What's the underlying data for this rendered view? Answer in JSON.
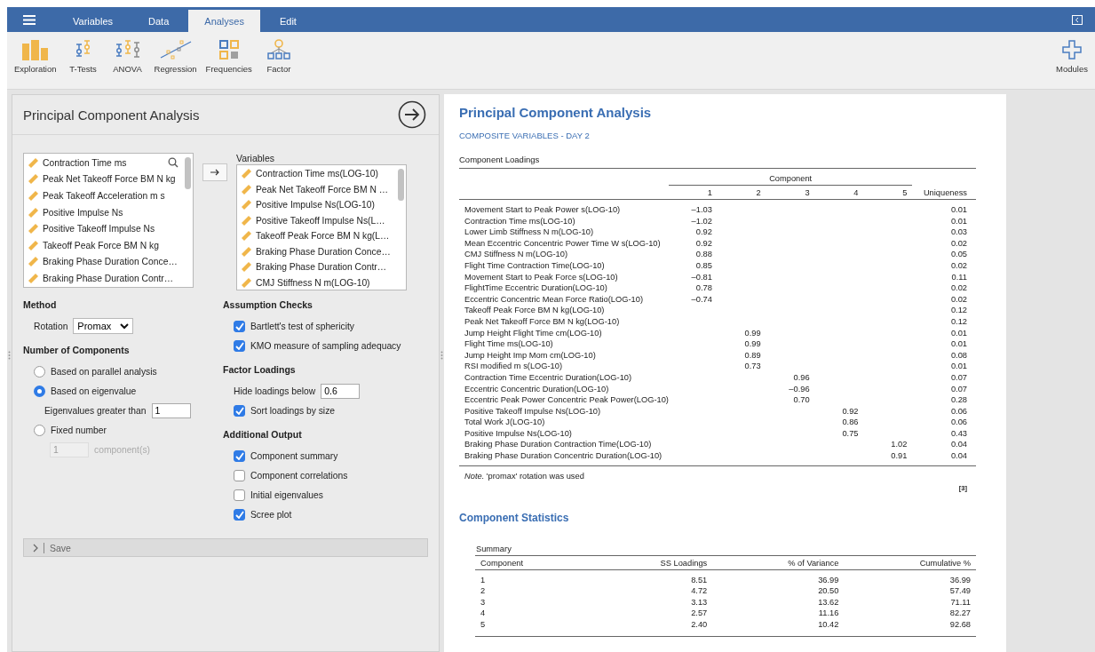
{
  "menu_tabs": [
    {
      "label": "Variables",
      "selected": false
    },
    {
      "label": "Data",
      "selected": false
    },
    {
      "label": "Analyses",
      "selected": true
    },
    {
      "label": "Edit",
      "selected": false
    }
  ],
  "ribbon": [
    "Exploration",
    "T-Tests",
    "ANOVA",
    "Regression",
    "Frequencies",
    "Factor"
  ],
  "modules": "Modules",
  "analysis_panel": {
    "title": "Principal Component Analysis",
    "source_variables": [
      "Contraction Time ms",
      "Peak Net Takeoff Force BM N kg",
      "Peak Takeoff Acceleration m s",
      "Positive Impulse Ns",
      "Positive Takeoff Impulse Ns",
      "Takeoff Peak Force BM N kg",
      "Braking Phase Duration Conce…",
      "Braking Phase Duration Contr…"
    ],
    "variables_label": "Variables",
    "variables": [
      "Contraction Time ms(LOG-10)",
      "Peak Net Takeoff Force BM N …",
      "Positive Impulse Ns(LOG-10)",
      "Positive Takeoff Impulse Ns(L…",
      "Takeoff Peak Force BM N kg(L…",
      "Braking Phase Duration Conce…",
      "Braking Phase Duration Contr…",
      "CMJ Stiffness N m(LOG-10)"
    ],
    "method": {
      "heading": "Method",
      "rotation_label": "Rotation",
      "rotation": "Promax"
    },
    "number_of_components": {
      "heading": "Number of Components",
      "options": [
        {
          "label": "Based on parallel analysis",
          "selected": false
        },
        {
          "label": "Based on eigenvalue",
          "selected": true,
          "field_label": "Eigenvalues greater than",
          "value": "1",
          "disabled": false
        },
        {
          "label": "Fixed number",
          "selected": false,
          "value": "1",
          "unit": "component(s)",
          "disabled": true
        }
      ]
    },
    "assumption_checks": {
      "heading": "Assumption Checks",
      "items": [
        {
          "label": "Bartlett's test of sphericity",
          "checked": true
        },
        {
          "label": "KMO measure of sampling adequacy",
          "checked": true
        }
      ]
    },
    "factor_loadings": {
      "heading": "Factor Loadings",
      "hide_label": "Hide loadings below",
      "hide_value": "0.6",
      "items": [
        {
          "label": "Sort loadings by size",
          "checked": true
        }
      ]
    },
    "additional_output": {
      "heading": "Additional Output",
      "items": [
        {
          "label": "Component summary",
          "checked": true
        },
        {
          "label": "Component correlations",
          "checked": false
        },
        {
          "label": "Initial eigenvalues",
          "checked": false
        },
        {
          "label": "Scree plot",
          "checked": true
        }
      ]
    },
    "save": {
      "label": "Save",
      "expanded": false
    }
  },
  "results": {
    "title": "Principal Component Analysis",
    "subtitle": "COMPOSITE VARIABLES - DAY 2",
    "loadings_table": {
      "caption": "Component Loadings",
      "group_header": "Component",
      "columns": [
        "1",
        "2",
        "3",
        "4",
        "5"
      ],
      "uniqueness_header": "Uniqueness",
      "rows": [
        {
          "name": "Movement Start to Peak Power s(LOG-10)",
          "loadings": {
            "1": "–1.03"
          },
          "uniqueness": "0.01"
        },
        {
          "name": "Contraction Time ms(LOG-10)",
          "loadings": {
            "1": "–1.02"
          },
          "uniqueness": "0.01"
        },
        {
          "name": "Lower Limb Stiffness N m(LOG-10)",
          "loadings": {
            "1": "0.92"
          },
          "uniqueness": "0.03"
        },
        {
          "name": "Mean Eccentric Concentric Power Time W s(LOG-10)",
          "loadings": {
            "1": "0.92"
          },
          "uniqueness": "0.02"
        },
        {
          "name": "CMJ Stiffness N m(LOG-10)",
          "loadings": {
            "1": "0.88"
          },
          "uniqueness": "0.05"
        },
        {
          "name": "Flight Time Contraction Time(LOG-10)",
          "loadings": {
            "1": "0.85"
          },
          "uniqueness": "0.02"
        },
        {
          "name": "Movement Start to Peak Force s(LOG-10)",
          "loadings": {
            "1": "–0.81"
          },
          "uniqueness": "0.11"
        },
        {
          "name": "FlightTime Eccentric Duration(LOG-10)",
          "loadings": {
            "1": "0.78"
          },
          "uniqueness": "0.02"
        },
        {
          "name": "Eccentric Concentric Mean Force Ratio(LOG-10)",
          "loadings": {
            "1": "–0.74"
          },
          "uniqueness": "0.02"
        },
        {
          "name": "Takeoff Peak Force BM N kg(LOG-10)",
          "uniqueness": "0.12"
        },
        {
          "name": "Peak Net Takeoff Force BM N kg(LOG-10)",
          "uniqueness": "0.12"
        },
        {
          "name": "Jump Height Flight Time cm(LOG-10)",
          "loadings": {
            "2": "0.99"
          },
          "uniqueness": "0.01"
        },
        {
          "name": "Flight Time ms(LOG-10)",
          "loadings": {
            "2": "0.99"
          },
          "uniqueness": "0.01"
        },
        {
          "name": "Jump Height Imp Mom cm(LOG-10)",
          "loadings": {
            "2": "0.89"
          },
          "uniqueness": "0.08"
        },
        {
          "name": "RSI modified m s(LOG-10)",
          "loadings": {
            "2": "0.73"
          },
          "uniqueness": "0.01"
        },
        {
          "name": "Contraction Time Eccentric Duration(LOG-10)",
          "loadings": {
            "3": "0.96"
          },
          "uniqueness": "0.07"
        },
        {
          "name": "Eccentric Concentric Duration(LOG-10)",
          "loadings": {
            "3": "–0.96"
          },
          "uniqueness": "0.07"
        },
        {
          "name": "Eccentric Peak Power Concentric Peak Power(LOG-10)",
          "loadings": {
            "3": "0.70"
          },
          "uniqueness": "0.28"
        },
        {
          "name": "Positive Takeoff Impulse Ns(LOG-10)",
          "loadings": {
            "4": "0.92"
          },
          "uniqueness": "0.06"
        },
        {
          "name": "Total Work J(LOG-10)",
          "loadings": {
            "4": "0.86"
          },
          "uniqueness": "0.06"
        },
        {
          "name": "Positive Impulse Ns(LOG-10)",
          "loadings": {
            "4": "0.75"
          },
          "uniqueness": "0.43"
        },
        {
          "name": "Braking Phase Duration Contraction Time(LOG-10)",
          "loadings": {
            "5": "1.02"
          },
          "uniqueness": "0.04"
        },
        {
          "name": "Braking Phase Duration Concentric Duration(LOG-10)",
          "loadings": {
            "5": "0.91"
          },
          "uniqueness": "0.04"
        }
      ],
      "note": "*Note.* 'promax' rotation was used",
      "reference": "[3]"
    },
    "statistics": {
      "title": "Component Statistics",
      "caption": "Summary",
      "columns": [
        "Component",
        "SS Loadings",
        "% of Variance",
        "Cumulative %"
      ],
      "rows": [
        {
          "component": "1",
          "ss_loadings": "8.51",
          "variance": "36.99",
          "cumulative": "36.99"
        },
        {
          "component": "2",
          "ss_loadings": "4.72",
          "variance": "20.50",
          "cumulative": "57.49"
        },
        {
          "component": "3",
          "ss_loadings": "3.13",
          "variance": "13.62",
          "cumulative": "71.11"
        },
        {
          "component": "4",
          "ss_loadings": "2.57",
          "variance": "11.16",
          "cumulative": "82.27"
        },
        {
          "component": "5",
          "ss_loadings": "2.40",
          "variance": "10.42",
          "cumulative": "92.68"
        }
      ]
    }
  }
}
